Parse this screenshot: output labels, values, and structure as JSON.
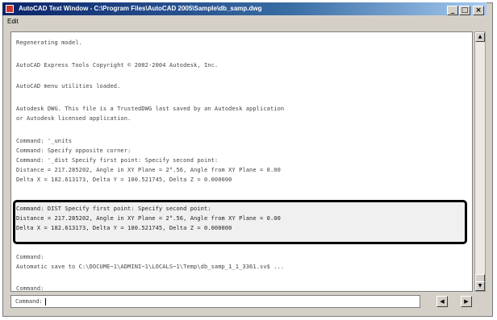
{
  "window": {
    "title": "AutoCAD Text Window - C:\\Program Files\\AutoCAD 2005\\Sample\\db_samp.dwg",
    "menu": [
      "Edit"
    ],
    "min_label": "_",
    "max_label": "□",
    "close_label": "×"
  },
  "history": [
    "Regenerating model.",
    "AutoCAD Express Tools Copyright © 2002-2004 Autodesk, Inc.",
    "AutoCAD menu utilities loaded.",
    "Autodesk DWG.  This file is a TrustedDWG last saved by an Autodesk application",
    "or Autodesk licensed application.",
    "Command: '_units",
    "Command: Specify opposite corner:",
    "Command: '_dist Specify first point:  Specify second point:",
    "Distance = 217.285202,  Angle in XY Plane = 2°.56,  Angle from XY Plane = 0.00",
    "Delta X = 182.613173,  Delta Y = 100.521745,   Delta Z = 0.000000",
    "Command: DIST Specify first point:  Specify second point:",
    "Distance = 217.285202,  Angle in XY Plane = 2°.56,  Angle from XY Plane = 0.00",
    "Delta X = 182.613173,  Delta Y = 100.521745,   Delta Z = 0.000000",
    "Command:",
    "Automatic save to C:\\DOCUME~1\\ADMINI~1\\LOCALS~1\\Temp\\db_samp_1_1_3361.sv$ ...",
    "Command:"
  ],
  "command_prompt": "Command:",
  "icons": {
    "app": "autocad-app-icon",
    "scroll_up": "arrow-up-icon",
    "scroll_down": "arrow-down-icon",
    "scroll_left": "arrow-left-icon",
    "scroll_right": "arrow-right-icon"
  },
  "colors": {
    "title_bar": "#0a246a",
    "highlight_border": "#000000",
    "text": "#444444"
  }
}
